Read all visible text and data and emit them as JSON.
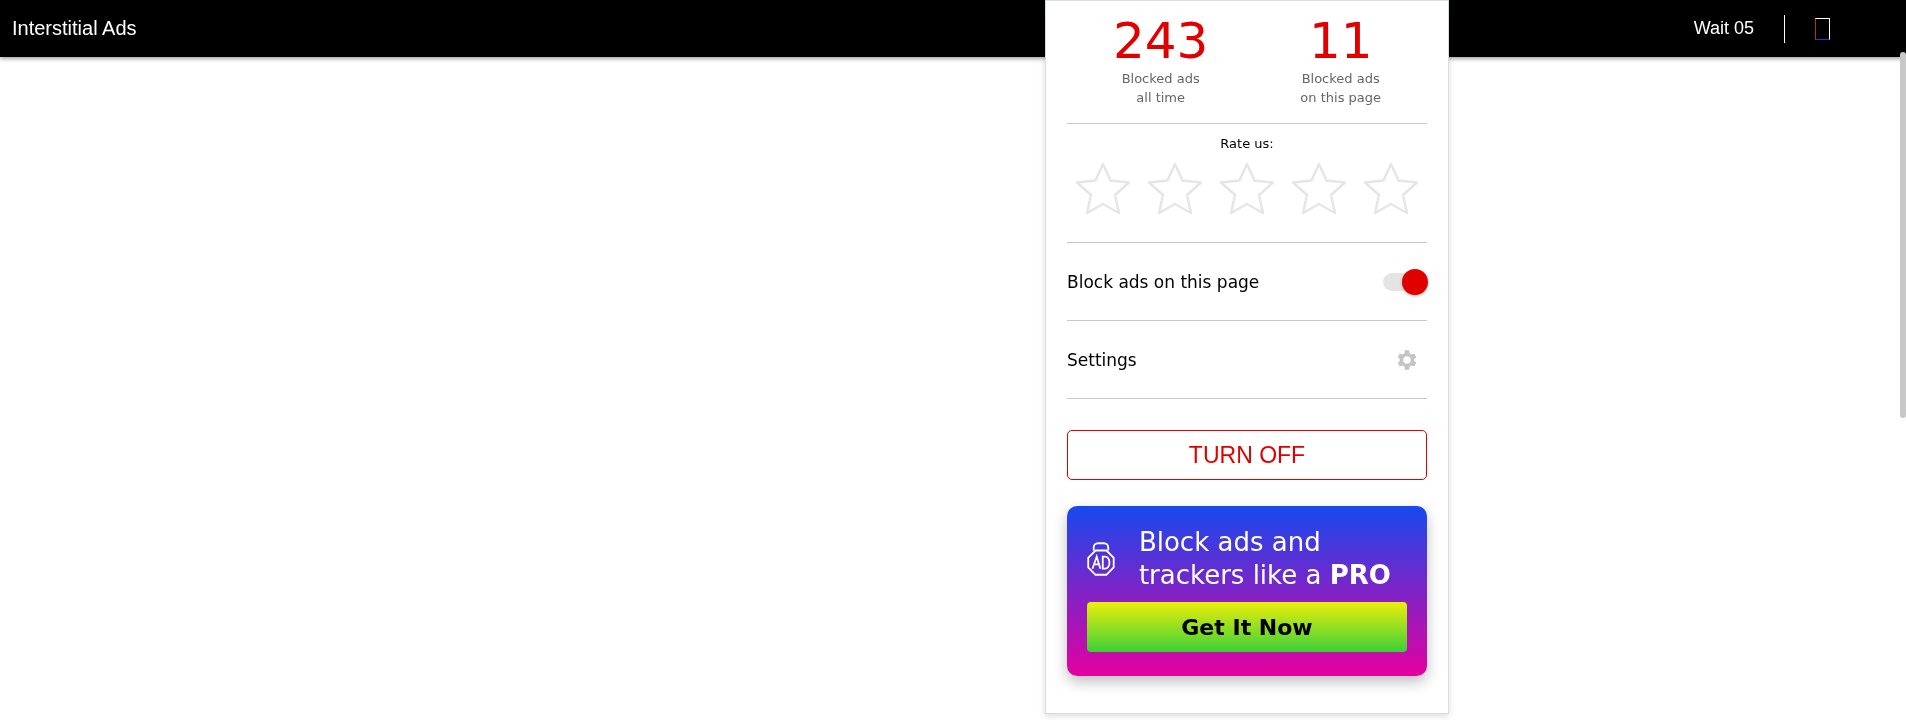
{
  "top_bar": {
    "title": "Interstitial Ads",
    "wait": "Wait 05"
  },
  "popup": {
    "stats": [
      {
        "count": "243",
        "label_line1": "Blocked ads",
        "label_line2": "all time"
      },
      {
        "count": "11",
        "label_line1": "Blocked ads",
        "label_line2": "on this page"
      }
    ],
    "rating": {
      "label": "Rate us:",
      "stars": 0
    },
    "block_toggle": {
      "label": "Block ads on this page",
      "on": true
    },
    "settings": {
      "label": "Settings"
    },
    "turn_off": {
      "label": "TURN OFF"
    },
    "promo": {
      "text": "Block ads and trackers like a **PRO**",
      "button": "Get It Now"
    }
  }
}
